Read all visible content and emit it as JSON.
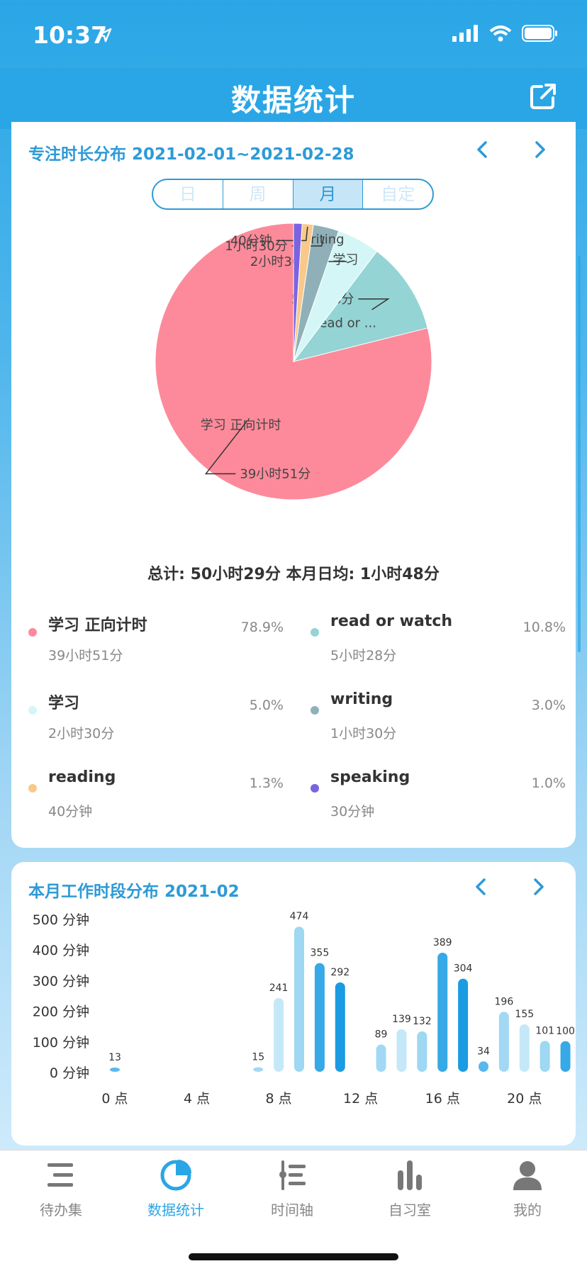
{
  "status_bar": {
    "time": "10:37"
  },
  "nav": {
    "title": "数据统计"
  },
  "focus_card": {
    "title": "专注时长分布 2021-02-01~2021-02-28",
    "segments": [
      {
        "label": "日",
        "active": false
      },
      {
        "label": "周",
        "active": false
      },
      {
        "label": "月",
        "active": true
      },
      {
        "label": "自定",
        "active": false
      }
    ],
    "total_text": "总计: 50小时29分  本月日均: 1小时48分",
    "legend": [
      {
        "name": "学习 正向计时",
        "duration": "39小时51分",
        "percent": "78.9%",
        "color": "#fd8a9a"
      },
      {
        "name": "read or watch",
        "duration": "5小时28分",
        "percent": "10.8%",
        "color": "#94d4d4"
      },
      {
        "name": "学习",
        "duration": "2小时30分",
        "percent": "5.0%",
        "color": "#d4f6f6"
      },
      {
        "name": "writing",
        "duration": "1小时30分",
        "percent": "3.0%",
        "color": "#8fb0b8"
      },
      {
        "name": "reading",
        "duration": "40分钟",
        "percent": "1.3%",
        "color": "#f8c98a"
      },
      {
        "name": "speaking",
        "duration": "30分钟",
        "percent": "1.0%",
        "color": "#7b63e0"
      }
    ]
  },
  "work_card": {
    "title": "本月工作时段分布  2021-02"
  },
  "chart_data": [
    {
      "type": "pie",
      "values": [
        78.9,
        10.8,
        5.0,
        3.0,
        1.3,
        1.0
      ],
      "categories": [
        "学习 正向计时",
        "read or watch",
        "学习",
        "writing",
        "reading",
        "speaking"
      ],
      "colors": [
        "#fd8a9a",
        "#94d4d4",
        "#d4f6f6",
        "#8fb0b8",
        "#f8c98a",
        "#7b63e0"
      ],
      "slice_labels": [
        "学习 正向计时",
        "read or ...",
        "学习",
        "writing",
        "",
        ""
      ],
      "callouts": [
        "39小时51分",
        "5小时28分",
        "2小时30分",
        "1小时30分",
        "40分钟",
        ""
      ]
    },
    {
      "type": "bar",
      "x": [
        0,
        7,
        8,
        9,
        10,
        11,
        13,
        14,
        15,
        16,
        17,
        18,
        19,
        20,
        21,
        22
      ],
      "values": [
        13,
        15,
        241,
        474,
        355,
        292,
        89,
        139,
        132,
        389,
        304,
        34,
        196,
        155,
        101,
        100
      ],
      "ylim": [
        0,
        500
      ],
      "ytick_labels": [
        "0 分钟",
        "100 分钟",
        "200 分钟",
        "300 分钟",
        "400 分钟",
        "500 分钟"
      ],
      "xtick_labels": [
        "0 点",
        "4 点",
        "8 点",
        "12 点",
        "16 点",
        "20 点"
      ],
      "xticks": [
        0,
        4,
        8,
        12,
        16,
        20
      ],
      "colors": [
        "#9ed8f2",
        "#36a9e6",
        "#1a9be2",
        "#58b8ec",
        "#a2d8f4",
        "#c5e8f8"
      ]
    }
  ],
  "tabbar": {
    "items": [
      {
        "label": "待办集",
        "icon": "list-icon",
        "active": false
      },
      {
        "label": "数据统计",
        "icon": "pie-chart-icon",
        "active": true
      },
      {
        "label": "时间轴",
        "icon": "timeline-icon",
        "active": false
      },
      {
        "label": "自习室",
        "icon": "bar-chart-icon",
        "active": false
      },
      {
        "label": "我的",
        "icon": "person-icon",
        "active": false
      }
    ]
  }
}
